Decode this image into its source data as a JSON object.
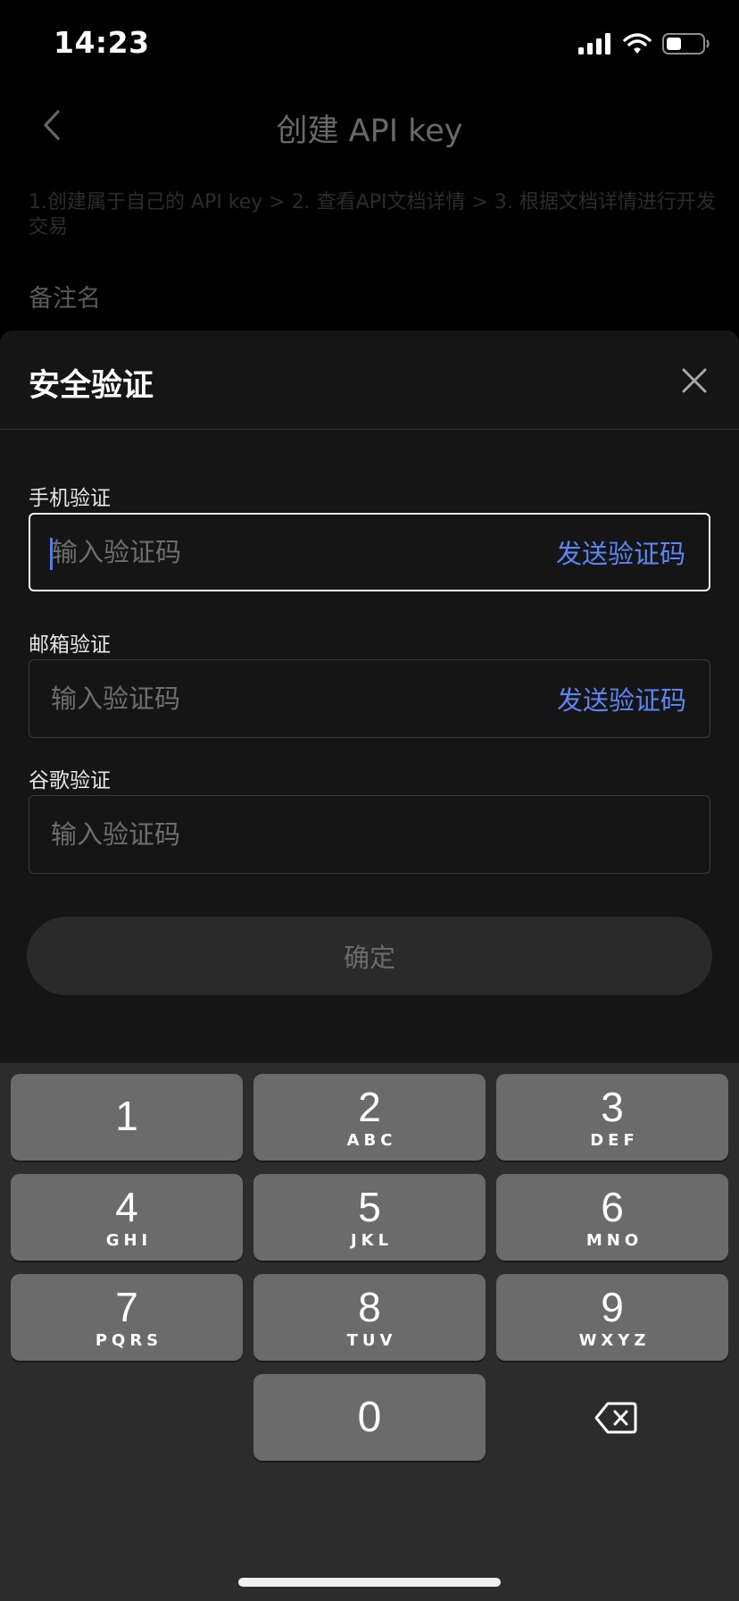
{
  "status_bar": {
    "time": "14:23"
  },
  "background_page": {
    "title": "创建 API key",
    "steps": "1.创建属于自己的 API key > 2. 查看API文档详情 > 3. 根据文档详情进行开发交易",
    "remark_label": "备注名"
  },
  "sheet": {
    "title": "安全验证",
    "phone": {
      "label": "手机验证",
      "placeholder": "输入验证码",
      "send_label": "发送验证码",
      "value": ""
    },
    "email": {
      "label": "邮箱验证",
      "placeholder": "输入验证码",
      "send_label": "发送验证码",
      "value": ""
    },
    "google": {
      "label": "谷歌验证",
      "placeholder": "输入验证码",
      "value": ""
    },
    "confirm_label": "确定"
  },
  "keypad": {
    "keys": [
      {
        "num": "1",
        "letters": ""
      },
      {
        "num": "2",
        "letters": "ABC"
      },
      {
        "num": "3",
        "letters": "DEF"
      },
      {
        "num": "4",
        "letters": "GHI"
      },
      {
        "num": "5",
        "letters": "JKL"
      },
      {
        "num": "6",
        "letters": "MNO"
      },
      {
        "num": "7",
        "letters": "PQRS"
      },
      {
        "num": "8",
        "letters": "TUV"
      },
      {
        "num": "9",
        "letters": "WXYZ"
      },
      {
        "num": "0",
        "letters": ""
      }
    ],
    "delete_icon": "delete-backspace-icon"
  },
  "colors": {
    "accent": "#5b86f5",
    "caret": "#4f7cff",
    "sheet_bg": "#151515",
    "keypad_bg": "#2c2c2c",
    "key_bg": "#6b6b6b"
  }
}
